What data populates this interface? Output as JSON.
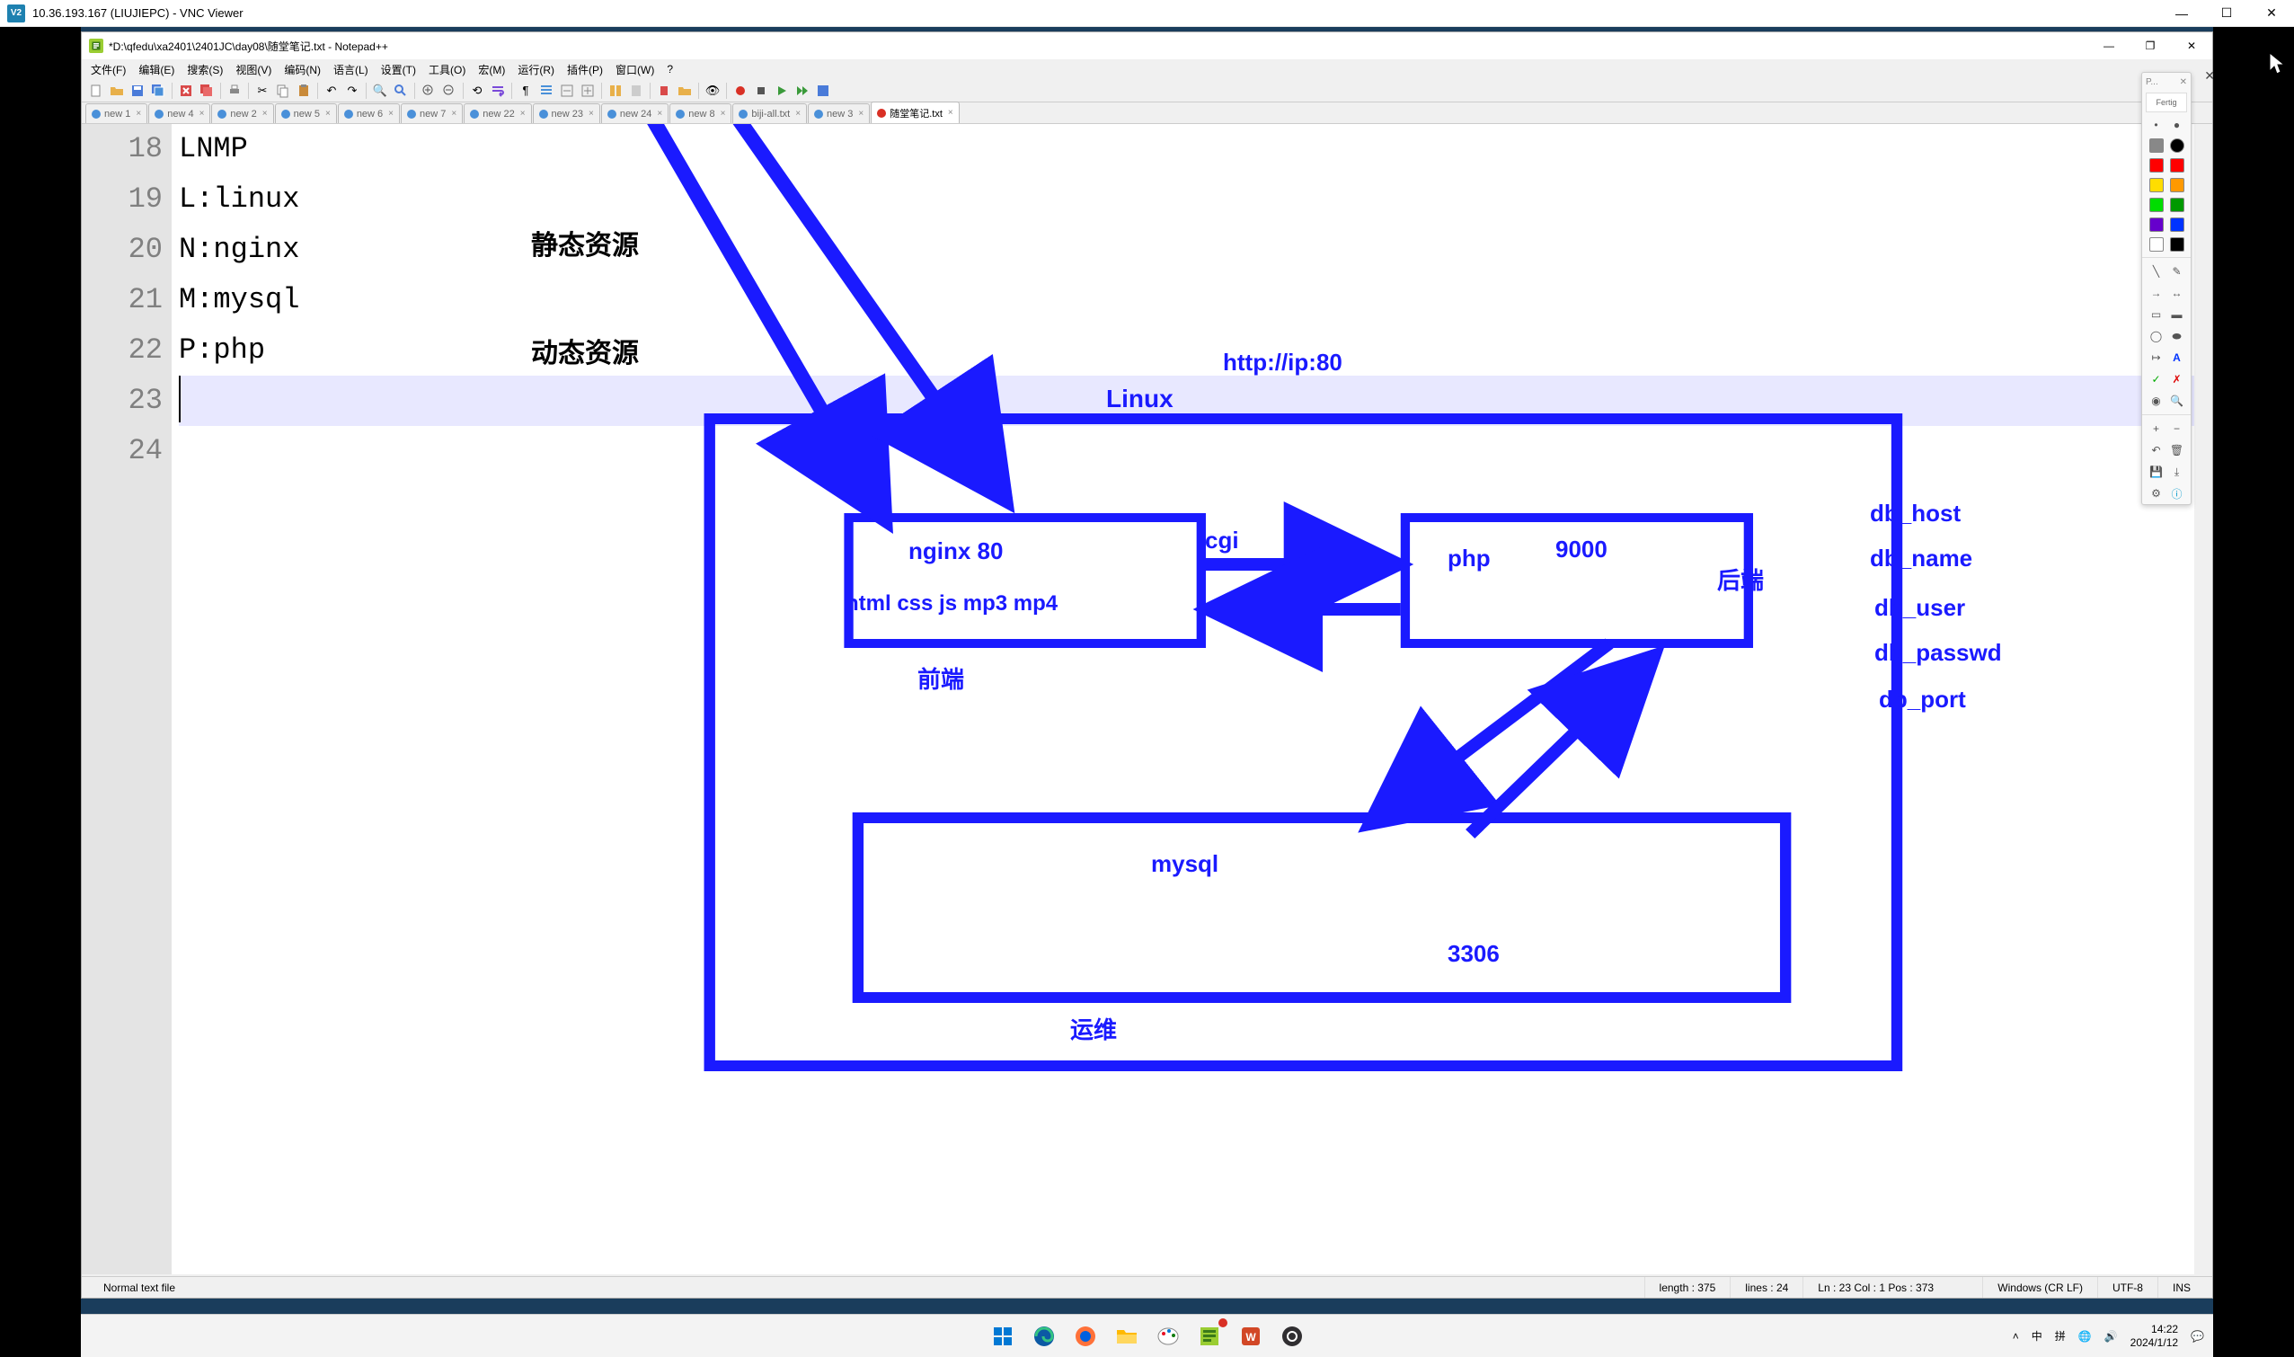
{
  "vnc": {
    "title": "10.36.193.167 (LIUJIEPC) - VNC Viewer",
    "icon_label": "V2"
  },
  "npp": {
    "title": "*D:\\qfedu\\xa2401\\2401JC\\day08\\随堂笔记.txt - Notepad++",
    "menu": [
      "文件(F)",
      "编辑(E)",
      "搜索(S)",
      "视图(V)",
      "编码(N)",
      "语言(L)",
      "设置(T)",
      "工具(O)",
      "宏(M)",
      "运行(R)",
      "插件(P)",
      "窗口(W)",
      "?"
    ],
    "tabs": [
      {
        "label": "new 1",
        "state": "blue"
      },
      {
        "label": "new 4",
        "state": "blue"
      },
      {
        "label": "new 2",
        "state": "blue"
      },
      {
        "label": "new 5",
        "state": "blue"
      },
      {
        "label": "new 6",
        "state": "blue"
      },
      {
        "label": "new 7",
        "state": "blue"
      },
      {
        "label": "new 22",
        "state": "blue"
      },
      {
        "label": "new 23",
        "state": "blue"
      },
      {
        "label": "new 24",
        "state": "blue"
      },
      {
        "label": "new 8",
        "state": "blue"
      },
      {
        "label": "biji-all.txt",
        "state": "blue"
      },
      {
        "label": "new 3",
        "state": "blue"
      },
      {
        "label": "随堂笔记.txt",
        "state": "red",
        "active": true
      }
    ],
    "gutter": [
      "18",
      "19",
      "20",
      "21",
      "22",
      "23",
      "24"
    ],
    "code": {
      "l18": "LNMP",
      "l19": "L:linux",
      "l20": "N:nginx",
      "l21": "M:mysql",
      "l22": "P:php",
      "l23": "",
      "l24": ""
    },
    "status": {
      "type": "Normal text file",
      "length": "length : 375",
      "lines": "lines : 24",
      "pos": "Ln : 23   Col : 1   Pos : 373",
      "eol": "Windows (CR LF)",
      "enc": "UTF-8",
      "ins": "INS"
    }
  },
  "overlay": {
    "static_res": "静态资源",
    "dynamic_res": "动态资源",
    "url": "http://ip:80",
    "linux": "Linux",
    "nginx": "nginx   80",
    "nginx_files": "html css js mp3 mp4",
    "frontend": "前端",
    "cgi": "cgi",
    "php": "php",
    "php_port": "9000",
    "backend": "后端",
    "mysql": "mysql",
    "mysql_port": "3306",
    "ops": "运维",
    "db_host": "db_host",
    "db_name": "db_name",
    "db_user": "db_user",
    "db_passwd": "db_passwd",
    "db_port": "db_port"
  },
  "palette": {
    "head": "P...",
    "done": "Fertig"
  },
  "tray": {
    "time": "14:22",
    "date": "2024/1/12",
    "ime": "拼"
  }
}
